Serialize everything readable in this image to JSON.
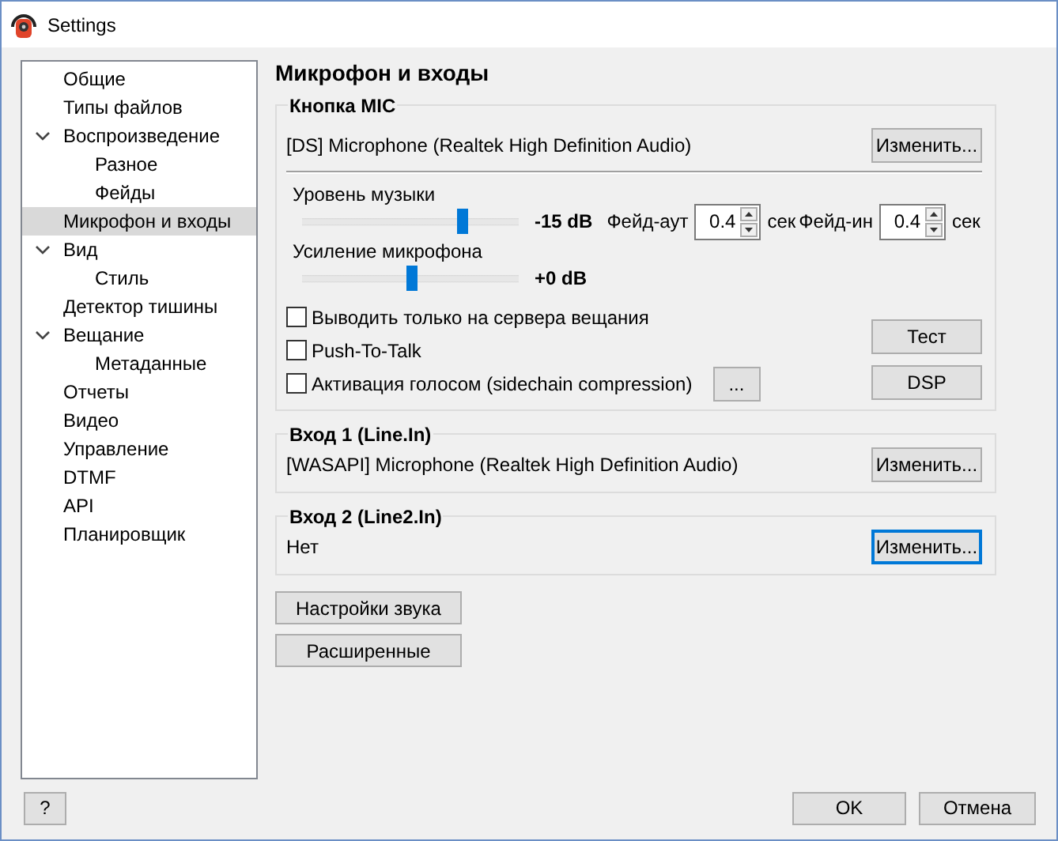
{
  "window": {
    "title": "Settings"
  },
  "sidebar": {
    "items": [
      {
        "label": "Общие",
        "selected": false
      },
      {
        "label": "Типы файлов",
        "selected": false
      },
      {
        "label": "Воспроизведение",
        "selected": false,
        "expanded": true,
        "children": [
          {
            "label": "Разное",
            "selected": false
          },
          {
            "label": "Фейды",
            "selected": false
          }
        ]
      },
      {
        "label": "Микрофон и входы",
        "selected": true
      },
      {
        "label": "Вид",
        "selected": false,
        "expanded": true,
        "children": [
          {
            "label": "Стиль",
            "selected": false
          }
        ]
      },
      {
        "label": "Детектор тишины",
        "selected": false
      },
      {
        "label": "Вещание",
        "selected": false,
        "expanded": true,
        "children": [
          {
            "label": "Метаданные",
            "selected": false
          }
        ]
      },
      {
        "label": "Отчеты",
        "selected": false
      },
      {
        "label": "Видео",
        "selected": false
      },
      {
        "label": "Управление",
        "selected": false
      },
      {
        "label": "DTMF",
        "selected": false
      },
      {
        "label": "API",
        "selected": false
      },
      {
        "label": "Планировщик",
        "selected": false
      }
    ]
  },
  "page": {
    "heading": "Микрофон и входы",
    "mic_group": {
      "title": "Кнопка MIC",
      "device": "[DS] Microphone (Realtek High Definition Audio)",
      "change_button": "Изменить...",
      "music_level": {
        "label": "Уровень музыки",
        "level": 0.74,
        "reading": "-15 dB"
      },
      "fade_out": {
        "label": "Фейд-аут",
        "value": "0.4",
        "unit": "сек"
      },
      "fade_in": {
        "label": "Фейд-ин",
        "value": "0.4",
        "unit": "сек"
      },
      "mic_gain": {
        "label": "Усиление микрофона",
        "level": 0.5,
        "reading": "+0 dB"
      },
      "checkboxes": [
        {
          "label": "Выводить только на сервера вещания",
          "checked": false
        },
        {
          "label": "Push-To-Talk",
          "checked": false
        },
        {
          "label": "Активация голосом (sidechain compression)",
          "checked": false
        }
      ],
      "more_button": "...",
      "test_button": "Тест",
      "dsp_button": "DSP"
    },
    "inputs": [
      {
        "title": "Вход 1 (Line.In)",
        "device": "[WASAPI] Microphone (Realtek High Definition Audio)",
        "change_button": "Изменить...",
        "focused": false
      },
      {
        "title": "Вход 2 (Line2.In)",
        "device": "Нет",
        "change_button": "Изменить...",
        "focused": true
      }
    ],
    "sound_settings_button": "Настройки звука",
    "advanced_button": "Расширенные"
  },
  "footer": {
    "help_button": "?",
    "ok_button": "OK",
    "cancel_button": "Отмена"
  }
}
